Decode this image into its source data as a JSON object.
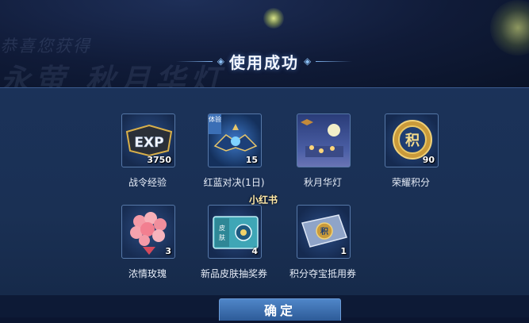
{
  "background": {
    "text_line_1": "恭喜您获得",
    "text_line_2": "永萤 秋月华灯"
  },
  "dialog": {
    "title": "使用成功",
    "confirm_label": "确定"
  },
  "rewards": [
    {
      "label": "战令经验",
      "count": "3750",
      "icon": "exp-badge-icon"
    },
    {
      "label": "红蓝对决(1日)",
      "count": "15",
      "icon": "red-blue-duel-icon",
      "tag": "体验"
    },
    {
      "label": "秋月华灯",
      "count": "",
      "icon": "autumn-lantern-icon"
    },
    {
      "label": "荣耀积分",
      "count": "90",
      "icon": "honor-points-coin-icon"
    },
    {
      "label": "浓情玫瑰",
      "count": "3",
      "icon": "rose-bouquet-icon"
    },
    {
      "label": "新品皮肤抽奖券",
      "count": "4",
      "icon": "skin-lottery-ticket-icon"
    },
    {
      "label": "积分夺宝抵用券",
      "count": "1",
      "icon": "points-treasure-coupon-icon"
    }
  ],
  "watermark": "小红书",
  "colors": {
    "panel": "#1b3259",
    "button": "#3f76b8",
    "gold": "#e0b84a"
  }
}
